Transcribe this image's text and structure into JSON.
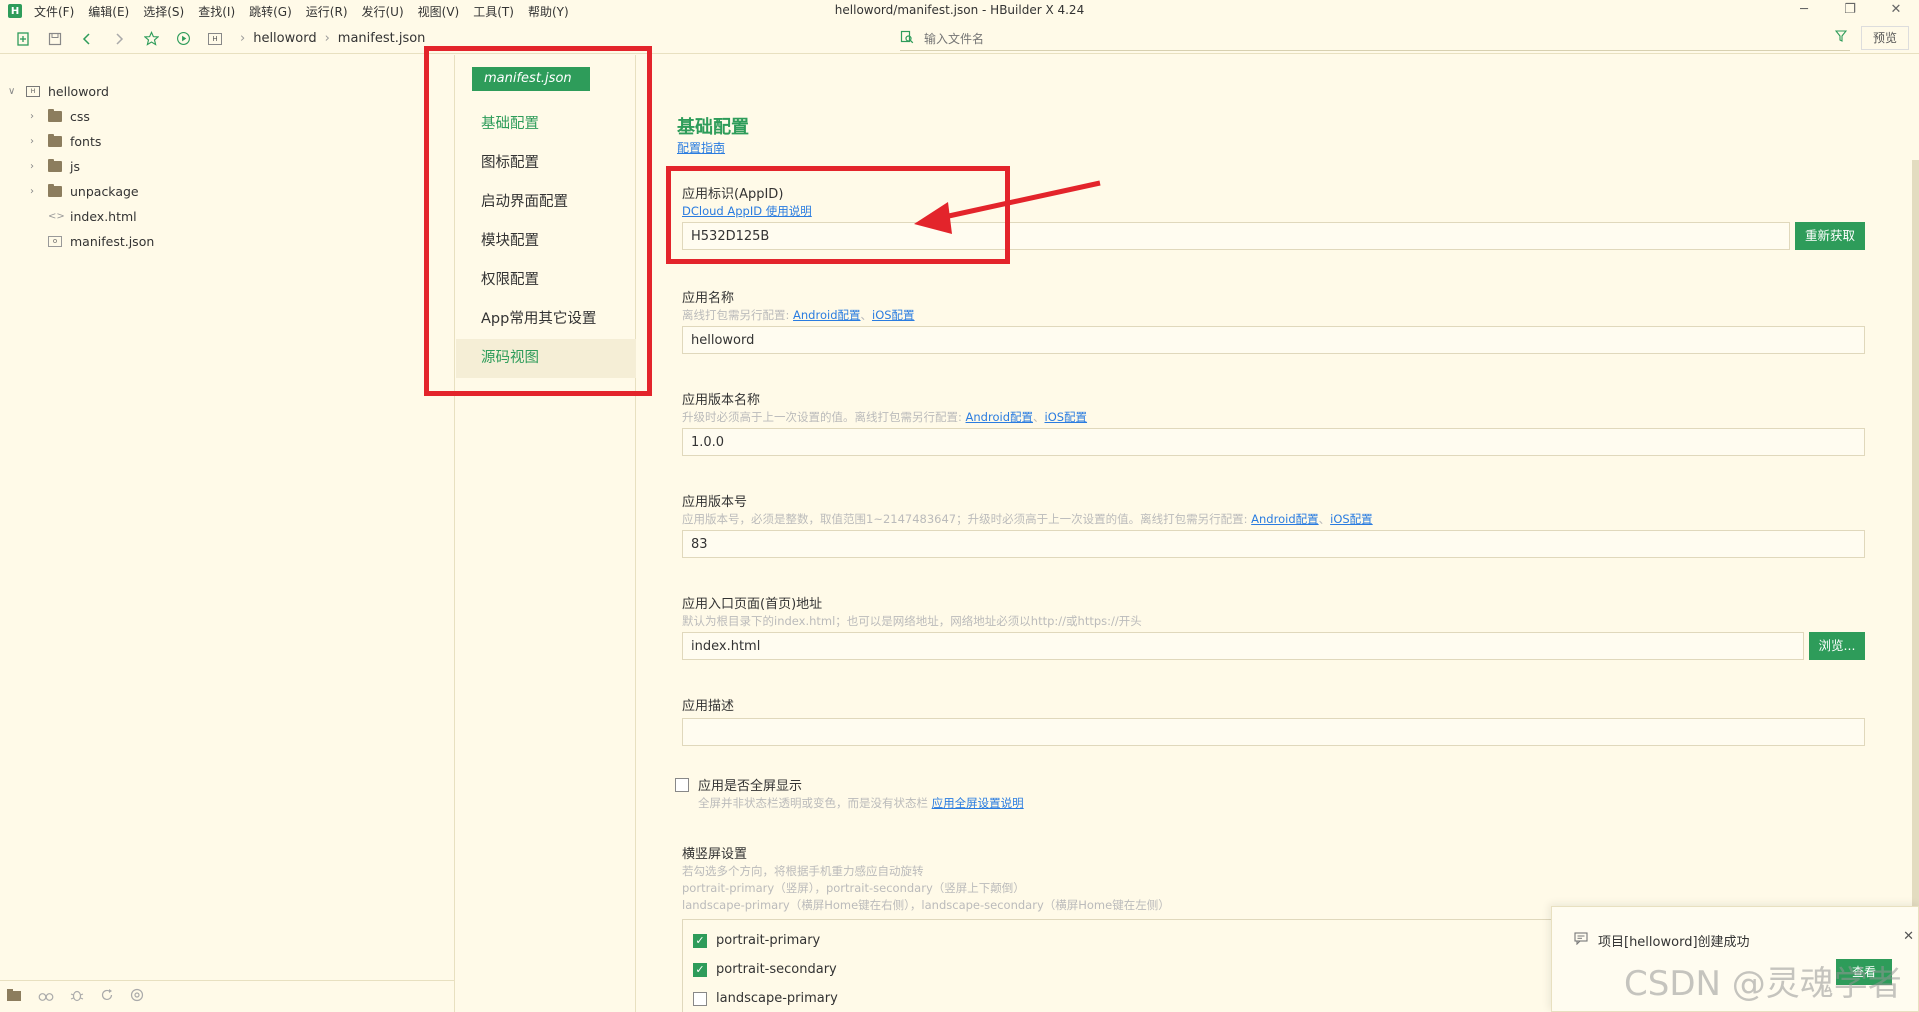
{
  "app": {
    "logo": "H",
    "window_title": "helloword/manifest.json - HBuilder X 4.24",
    "menu": [
      "文件(F)",
      "编辑(E)",
      "选择(S)",
      "查找(I)",
      "跳转(G)",
      "运行(R)",
      "发行(U)",
      "视图(V)",
      "工具(T)",
      "帮助(Y)"
    ],
    "controls": {
      "minimize": "─",
      "restore": "❐",
      "close": "✕"
    }
  },
  "toolbar": {
    "breadcrumb": [
      "helloword",
      "manifest.json"
    ],
    "search_placeholder": "输入文件名",
    "preview_label": "预览"
  },
  "tree": {
    "root": "helloword",
    "items": [
      {
        "name": "css",
        "type": "folder"
      },
      {
        "name": "fonts",
        "type": "folder"
      },
      {
        "name": "js",
        "type": "folder"
      },
      {
        "name": "unpackage",
        "type": "folder"
      },
      {
        "name": "index.html",
        "type": "html"
      },
      {
        "name": "manifest.json",
        "type": "json"
      }
    ]
  },
  "nav": {
    "badge": "manifest.json",
    "items": [
      "基础配置",
      "图标配置",
      "启动界面配置",
      "模块配置",
      "权限配置",
      "App常用其它设置",
      "源码视图"
    ]
  },
  "main": {
    "section_title": "基础配置",
    "guide_link": "配置指南",
    "appid": {
      "label": "应用标识(AppID)",
      "hint_link": "DCloud AppID 使用说明",
      "value": "H532D125B",
      "button": "重新获取"
    },
    "appname": {
      "label": "应用名称",
      "hint": "离线打包需另行配置: ",
      "link_android": "Android配置",
      "sep": "、",
      "link_ios": "iOS配置",
      "value": "helloword"
    },
    "version_name": {
      "label": "应用版本名称",
      "hint": "升级时必须高于上一次设置的值。离线打包需另行配置: ",
      "link_android": "Android配置",
      "sep": "、",
      "link_ios": "iOS配置",
      "value": "1.0.0"
    },
    "version_code": {
      "label": "应用版本号",
      "hint": "应用版本号，必须是整数，取值范围1~2147483647；升级时必须高于上一次设置的值。离线打包需另行配置: ",
      "link_android": "Android配置",
      "sep": "、",
      "link_ios": "iOS配置",
      "value": "83"
    },
    "entry": {
      "label": "应用入口页面(首页)地址",
      "hint": "默认为根目录下的index.html；也可以是网络地址，网络地址必须以http://或https://开头",
      "value": "index.html",
      "button": "浏览..."
    },
    "description": {
      "label": "应用描述",
      "value": ""
    },
    "fullscreen": {
      "label": "应用是否全屏显示",
      "hint": "全屏并非状态栏透明或变色，而是没有状态栏 ",
      "link": "应用全屏设置说明",
      "checked": false
    },
    "orientation": {
      "label": "横竖屏设置",
      "hint1": "若勾选多个方向，将根据手机重力感应自动旋转",
      "hint2": "portrait-primary（竖屏），portrait-secondary（竖屏上下颠倒）",
      "hint3": "landscape-primary（横屏Home键在右侧），landscape-secondary（横屏Home键在左侧）",
      "options": [
        {
          "label": "portrait-primary",
          "checked": true
        },
        {
          "label": "portrait-secondary",
          "checked": true
        },
        {
          "label": "landscape-primary",
          "checked": false
        }
      ]
    }
  },
  "toast": {
    "message": "项目[helloword]创建成功",
    "button": "查看",
    "close": "✕"
  },
  "watermark": "CSDN @灵魂学者",
  "colors": {
    "accent": "#2e9c5a",
    "link": "#2a7ce0",
    "annotation": "#e3242b",
    "background": "#fffae8"
  }
}
